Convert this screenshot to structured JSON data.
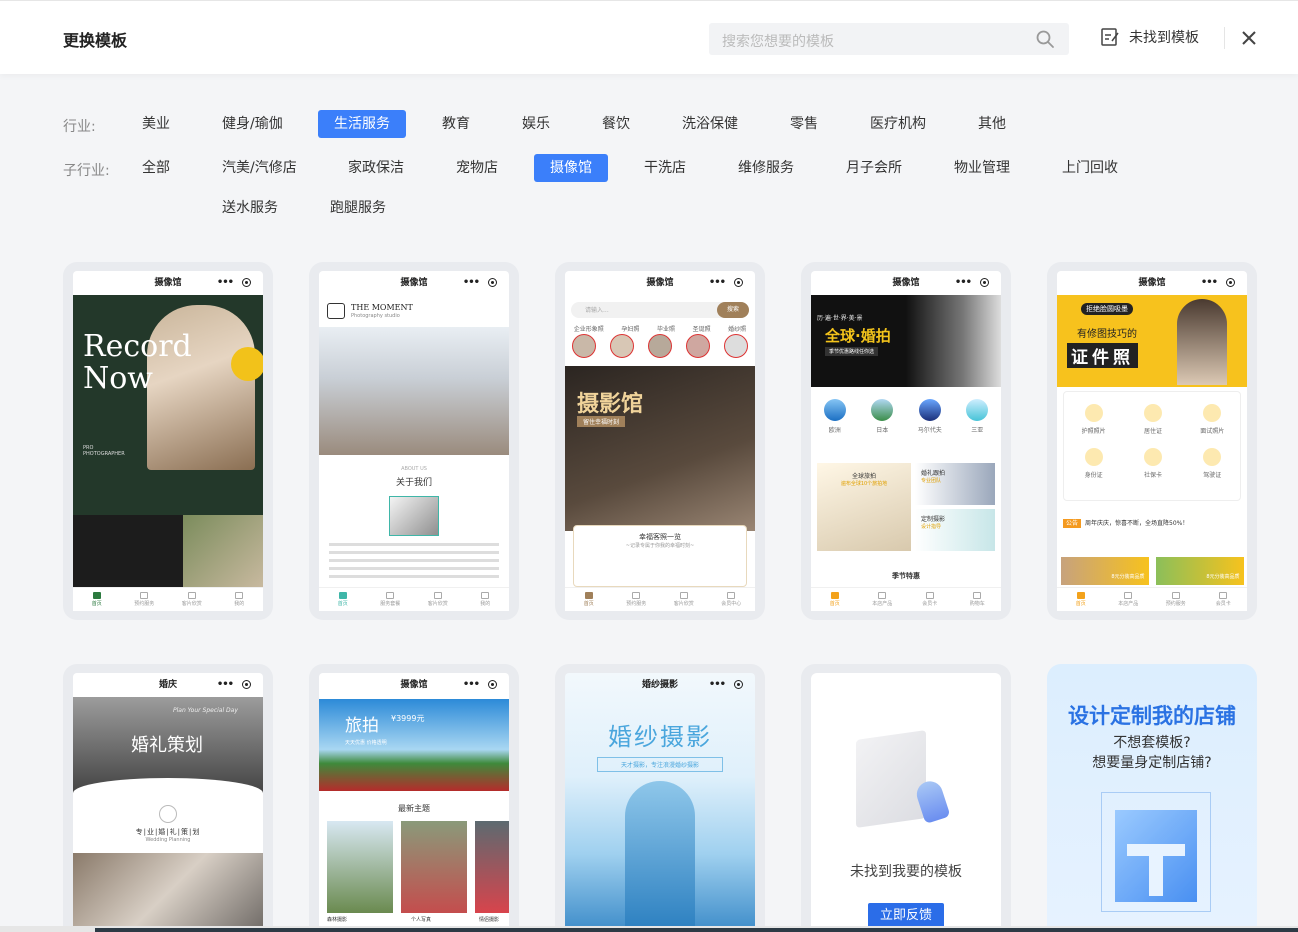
{
  "header": {
    "title": "更换模板",
    "search_placeholder": "搜索您想要的模板",
    "not_found_label": "未找到模板"
  },
  "industry": {
    "label": "行业:",
    "items": [
      "美业",
      "健身/瑜伽",
      "生活服务",
      "教育",
      "娱乐",
      "餐饮",
      "洗浴保健",
      "零售",
      "医疗机构",
      "其他"
    ],
    "active": "生活服务"
  },
  "sub_industry": {
    "label": "子行业:",
    "items": [
      "全部",
      "汽美/汽修店",
      "家政保洁",
      "宠物店",
      "摄像馆",
      "干洗店",
      "维修服务",
      "月子会所",
      "物业管理",
      "上门回收",
      "送水服务",
      "跑腿服务"
    ],
    "active": "摄像馆"
  },
  "colors": {
    "accent": "#3b7ffa",
    "bg": "#f4f5f7"
  },
  "templates": [
    {
      "page_title": "摄像馆",
      "hero_text_1": "Record",
      "hero_text_2": "Now",
      "hero_sub": "PRO PHOTOGRAPHER",
      "tabs": [
        "首页",
        "预约服务",
        "客片欣赏",
        "我的"
      ]
    },
    {
      "page_title": "摄像馆",
      "brand": "THE MOMENT",
      "brand_sub": "Photography studio",
      "section_title": "关于我们",
      "section_en": "ABOUT US",
      "tabs": [
        "首页",
        "服务套餐",
        "客片欣赏",
        "我的"
      ]
    },
    {
      "page_title": "摄像馆",
      "search_placeholder": "请输入...",
      "search_button": "搜索",
      "cats": [
        "企业形象照",
        "孕妇照",
        "毕业照",
        "圣诞照",
        "婚纱照"
      ],
      "hero_title": "摄影馆",
      "hero_sub": "留住幸福时刻",
      "gallery_title": "幸福客照一览",
      "gallery_sub": "~记录专属于你我的幸福时刻~",
      "tabs": [
        "首页",
        "预约服务",
        "客片欣赏",
        "会员中心"
      ]
    },
    {
      "page_title": "摄像馆",
      "hero_small": "历·遍·世·界·美·景",
      "hero_title": "全球·婚拍",
      "hero_sub": "季节优惠路线任你选",
      "places": [
        "欧洲",
        "日本",
        "马尔代夫",
        "三亚"
      ],
      "promo_1": "全球旅拍",
      "promo_1_sub": "遍布全球10个旅拍地",
      "promo_2": "婚礼跟拍",
      "promo_2_sub": "专业团队",
      "promo_3": "定制摄影",
      "promo_3_sub": "设计指导",
      "section": "季节特惠",
      "tabs": [
        "首页",
        "本店产品",
        "会员卡",
        "购物车"
      ]
    },
    {
      "page_title": "摄像馆",
      "hero_tag": "拒绝脸圆吸墨",
      "hero_line": "有修图技巧的",
      "hero_title": "证件照",
      "services": [
        "护照照片",
        "居住证",
        "面试照片",
        "身份证",
        "社保卡",
        "驾驶证"
      ],
      "notice": "周年庆庆，惊喜不断，全场直降50%！",
      "notice_tag": "公告",
      "promo": "8元分装高品质",
      "tabs": [
        "首页",
        "本店产品",
        "预约服务",
        "会员卡"
      ]
    },
    {
      "page_title": "婚庆",
      "hero_en": "Plan Your Special Day",
      "hero_title": "婚礼策划",
      "sub_title": "专|业|婚|礼|策|划",
      "sub_en": "Wedding Planning"
    },
    {
      "page_title": "摄像馆",
      "hero_title": "旅拍",
      "hero_price": "¥3999元",
      "hero_tags": [
        "天天优惠",
        "价格透明"
      ],
      "section_title": "最新主题",
      "themes": [
        "森林摄影",
        "个人写真",
        "情侣摄影"
      ]
    },
    {
      "page_title": "婚纱摄影",
      "hero_title": "婚纱摄影",
      "hero_sub": "天才摄影，专注浪漫婚纱摄影"
    },
    {
      "message": "未找到我要的模板",
      "button": "立即反馈"
    },
    {
      "title": "设计定制我的店铺",
      "line1": "不想套模板?",
      "line2": "想要量身定制店铺?"
    }
  ]
}
